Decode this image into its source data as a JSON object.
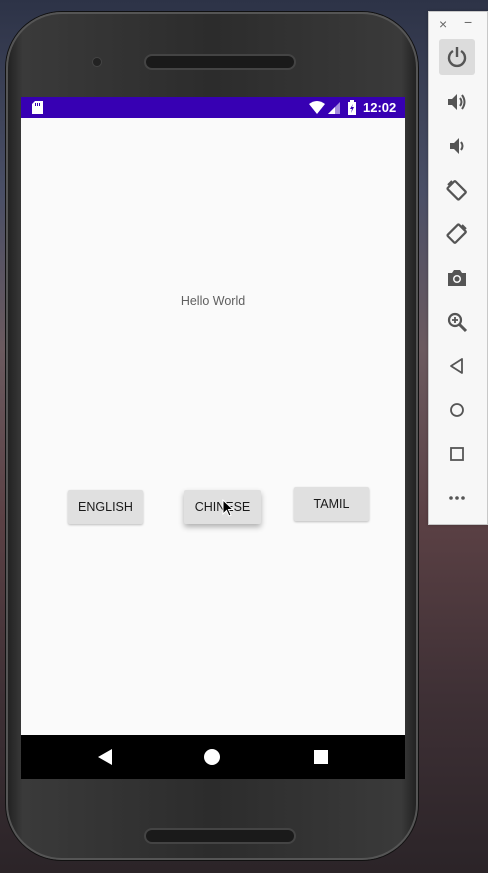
{
  "statusbar": {
    "time": "12:02",
    "color": "#3700b3"
  },
  "app": {
    "greeting": "Hello World",
    "buttons": {
      "english": "ENGLISH",
      "chinese": "CHINESE",
      "tamil": "TAMIL"
    }
  },
  "navbar": {
    "icons": [
      "back-icon",
      "home-icon",
      "recents-icon"
    ]
  },
  "emulator_toolbar": {
    "window_controls": {
      "close": "×",
      "minimize": "−"
    },
    "tools": [
      "power-icon",
      "volume-up-icon",
      "volume-down-icon",
      "rotate-left-icon",
      "rotate-right-icon",
      "camera-icon",
      "zoom-icon",
      "back-icon",
      "home-icon",
      "overview-icon",
      "more-icon"
    ]
  }
}
